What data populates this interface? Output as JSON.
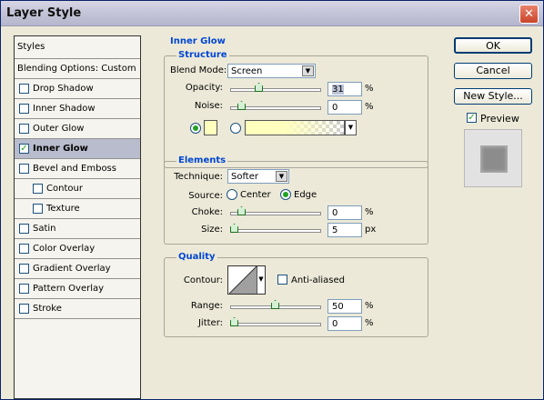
{
  "window": {
    "title": "Layer Style"
  },
  "styles_panel": {
    "header": "Styles",
    "blending": "Blending Options: Custom",
    "items": [
      {
        "label": "Drop Shadow",
        "checked": false
      },
      {
        "label": "Inner Shadow",
        "checked": false
      },
      {
        "label": "Outer Glow",
        "checked": false
      },
      {
        "label": "Inner Glow",
        "checked": true
      },
      {
        "label": "Bevel and Emboss",
        "checked": false
      },
      {
        "label": "Contour",
        "checked": false
      },
      {
        "label": "Texture",
        "checked": false
      },
      {
        "label": "Satin",
        "checked": false
      },
      {
        "label": "Color Overlay",
        "checked": false
      },
      {
        "label": "Gradient Overlay",
        "checked": false
      },
      {
        "label": "Pattern Overlay",
        "checked": false
      },
      {
        "label": "Stroke",
        "checked": false
      }
    ]
  },
  "inner_glow": {
    "title": "Inner Glow",
    "structure": {
      "title": "Structure",
      "blend_mode_label": "Blend Mode:",
      "blend_mode": "Screen",
      "opacity_label": "Opacity:",
      "opacity": "31",
      "opacity_unit": "%",
      "noise_label": "Noise:",
      "noise": "0",
      "noise_unit": "%",
      "glow_color": "#ffffbe"
    },
    "elements": {
      "title": "Elements",
      "technique_label": "Technique:",
      "technique": "Softer",
      "source_label": "Source:",
      "source_center": "Center",
      "source_edge": "Edge",
      "choke_label": "Choke:",
      "choke": "0",
      "choke_unit": "%",
      "size_label": "Size:",
      "size": "5",
      "size_unit": "px"
    },
    "quality": {
      "title": "Quality",
      "contour_label": "Contour:",
      "anti_aliased": "Anti-aliased",
      "range_label": "Range:",
      "range": "50",
      "range_unit": "%",
      "jitter_label": "Jitter:",
      "jitter": "0",
      "jitter_unit": "%"
    }
  },
  "buttons": {
    "ok": "OK",
    "cancel": "Cancel",
    "new_style": "New Style...",
    "preview": "Preview"
  },
  "preview_checked": true
}
